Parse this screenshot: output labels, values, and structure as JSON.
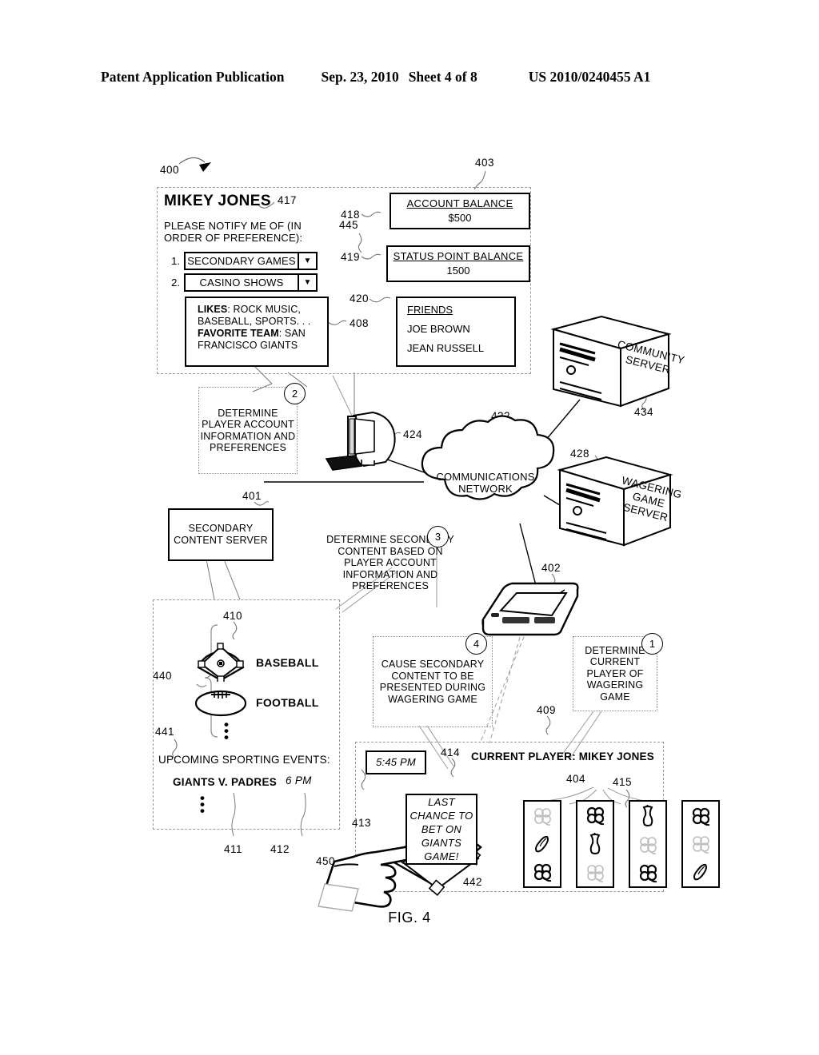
{
  "header": {
    "publication": "Patent Application Publication",
    "date": "Sep. 23, 2010",
    "sheet": "Sheet 4 of 8",
    "number": "US 2010/0240455 A1"
  },
  "figure": {
    "caption": "FIG. 4",
    "diagram_ref": "400"
  },
  "player_panel": {
    "ref": "403",
    "name": "MIKEY JONES",
    "name_ref": "417",
    "notify_prompt": "PLEASE NOTIFY ME OF (IN ORDER OF PREFERENCE):",
    "notify_ref": "445",
    "preferences": [
      {
        "index": "1.",
        "value": "SECONDARY GAMES",
        "arrow": "▼"
      },
      {
        "index": "2.",
        "value": "CASINO SHOWS",
        "arrow": "▼"
      }
    ],
    "profile_ref": "408",
    "profile": {
      "likes_label": "LIKES",
      "likes_value": ": ROCK MUSIC, BASEBALL, SPORTS. . .",
      "team_label": "FAVORITE TEAM",
      "team_value": ": SAN FRANCISCO GIANTS"
    },
    "account_balance": {
      "ref": "418",
      "title": "ACCOUNT  BALANCE",
      "value": "$500"
    },
    "status_points": {
      "ref": "419",
      "title": "STATUS POINT BALANCE",
      "value": "1500"
    },
    "friends": {
      "ref": "420",
      "title": "FRIENDS",
      "names": [
        "JOE BROWN",
        "JEAN RUSSELL"
      ]
    }
  },
  "steps": [
    {
      "num": "2",
      "text": "DETERMINE PLAYER ACCOUNT INFORMATION AND PREFERENCES"
    },
    {
      "num": "3",
      "text": "DETERMINE SECONDARY CONTENT BASED ON PLAYER ACCOUNT INFORMATION AND PREFERENCES"
    },
    {
      "num": "4",
      "text": "CAUSE SECONDARY CONTENT TO BE PRESENTED DURING WAGERING GAME"
    },
    {
      "num": "1",
      "text": "DETERMINE CURRENT PLAYER OF WAGERING GAME"
    }
  ],
  "nodes": {
    "secondary_content_server": {
      "ref": "401",
      "label": "SECONDARY CONTENT SERVER"
    },
    "workstation": {
      "ref": "424",
      "name": "player-terminal"
    },
    "network": {
      "ref": "422",
      "label": "COMMUNICATIONS NETWORK"
    },
    "community_server": {
      "ref": "434",
      "label_line1": "COMMUNITY",
      "label_line2": "SERVER"
    },
    "wagering_game_server": {
      "ref": "428",
      "label_line1": "WAGERING",
      "label_line2": "GAME",
      "label_line3": "SERVER"
    },
    "handheld": {
      "ref": "402",
      "name": "handheld-wagering-terminal"
    }
  },
  "content_region": {
    "ref_group": "440",
    "ref_events": "441",
    "ref_baseball": "410",
    "ref_event_name": "411",
    "ref_event_time": "412",
    "categories": [
      {
        "icon": "baseball-diamond-icon",
        "label": "BASEBALL"
      },
      {
        "icon": "football-icon",
        "label": "FOOTBALL"
      }
    ],
    "events_heading": "UPCOMING SPORTING EVENTS:",
    "events": [
      {
        "name": "GIANTS V. PADRES",
        "time": "6 PM"
      }
    ],
    "ellipsis": "•\n•\n•"
  },
  "game_region": {
    "ref": "409",
    "clock": {
      "ref": "413",
      "value": "5:45 PM"
    },
    "current_player": {
      "ref": "414",
      "text": "CURRENT PLAYER: MIKEY JONES"
    },
    "secondary_message": {
      "ref": "442",
      "text": "LAST CHANCE TO BET ON GIANTS GAME!"
    },
    "hand_ref": "450",
    "reels": {
      "ref": "404",
      "ref_alt": "415",
      "symbols": [
        [
          "clover-faint-icon",
          "carrot-icon",
          "clover-icon"
        ],
        [
          "clover-icon",
          "apple-core-icon",
          "clover-faint-icon"
        ],
        [
          "apple-core-icon",
          "clover-faint-icon",
          "clover-icon"
        ],
        [
          "clover-icon",
          "clover-faint-icon",
          "carrot-icon"
        ]
      ]
    }
  }
}
